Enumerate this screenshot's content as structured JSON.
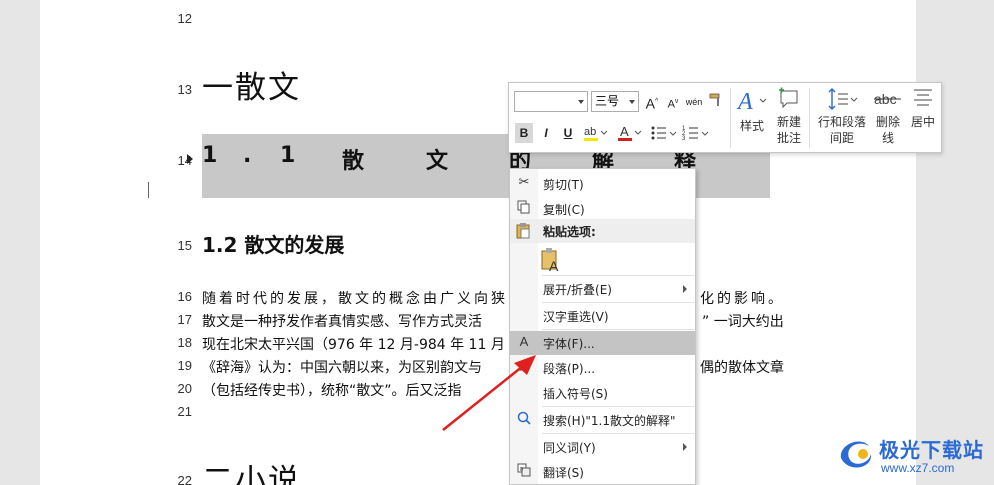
{
  "document": {
    "line_numbers": [
      "12",
      "13",
      "14",
      "15",
      "16",
      "17",
      "18",
      "19",
      "20",
      "21",
      "22"
    ],
    "heading1_a": "一散文",
    "heading2_parts": [
      "1",
      ".",
      "1",
      "散",
      "文",
      "的",
      "解",
      "释"
    ],
    "heading3": "1.2 散文的发展",
    "para_lines": [
      "随着时代的发展，散文的概念由广义向狭",
      "散文是一种抒发作者真情实感、写作方式灵活",
      "现在北宋太平兴国（976 年 12 月-984 年 11 月",
      "《辞海》认为：中国六朝以来，为区别韵文与",
      "（包括经传史书），统称“散文”。后又泛指"
    ],
    "para_tails": [
      "化的影响。",
      "” 一词大约出",
      "",
      "偶的散体文章",
      ""
    ],
    "heading1_b": "二小说"
  },
  "mini_toolbar": {
    "font_name": "",
    "font_size": "三号",
    "grow_font": "A",
    "shrink_font": "A",
    "bold": "B",
    "italic": "I",
    "underline": "U",
    "styles_label": "样式",
    "new_comment_label": "新建\n批注",
    "line_spacing_label": "行和段落\n间距",
    "strikethrough_label": "删除\n线",
    "center_label": "居中"
  },
  "context_menu": {
    "items": [
      {
        "label": "剪切(T)",
        "icon": "scissors-icon"
      },
      {
        "label": "复制(C)",
        "icon": "copy-icon"
      },
      {
        "label": "粘贴选项:",
        "icon": "paste-icon"
      },
      {
        "label": "展开/折叠(E)",
        "icon": "",
        "submenu": true
      },
      {
        "label": "汉字重选(V)",
        "icon": ""
      },
      {
        "label": "字体(F)...",
        "icon": "font-icon"
      },
      {
        "label": "段落(P)...",
        "icon": "paragraph-icon"
      },
      {
        "label": "插入符号(S)",
        "icon": ""
      },
      {
        "label": "搜索(H)\"1.1散文的解释\"",
        "icon": "search-icon"
      },
      {
        "label": "同义词(Y)",
        "icon": "",
        "submenu": true
      },
      {
        "label": "翻译(S)",
        "icon": "translate-icon"
      }
    ]
  },
  "watermark": {
    "title": "极光下载站",
    "url": "www.xz7.com"
  },
  "colors": {
    "highlight_yellow": "#f5e600",
    "font_red": "#d42020",
    "accent_blue": "#2a6ad2",
    "arrow_red": "#e02020"
  }
}
